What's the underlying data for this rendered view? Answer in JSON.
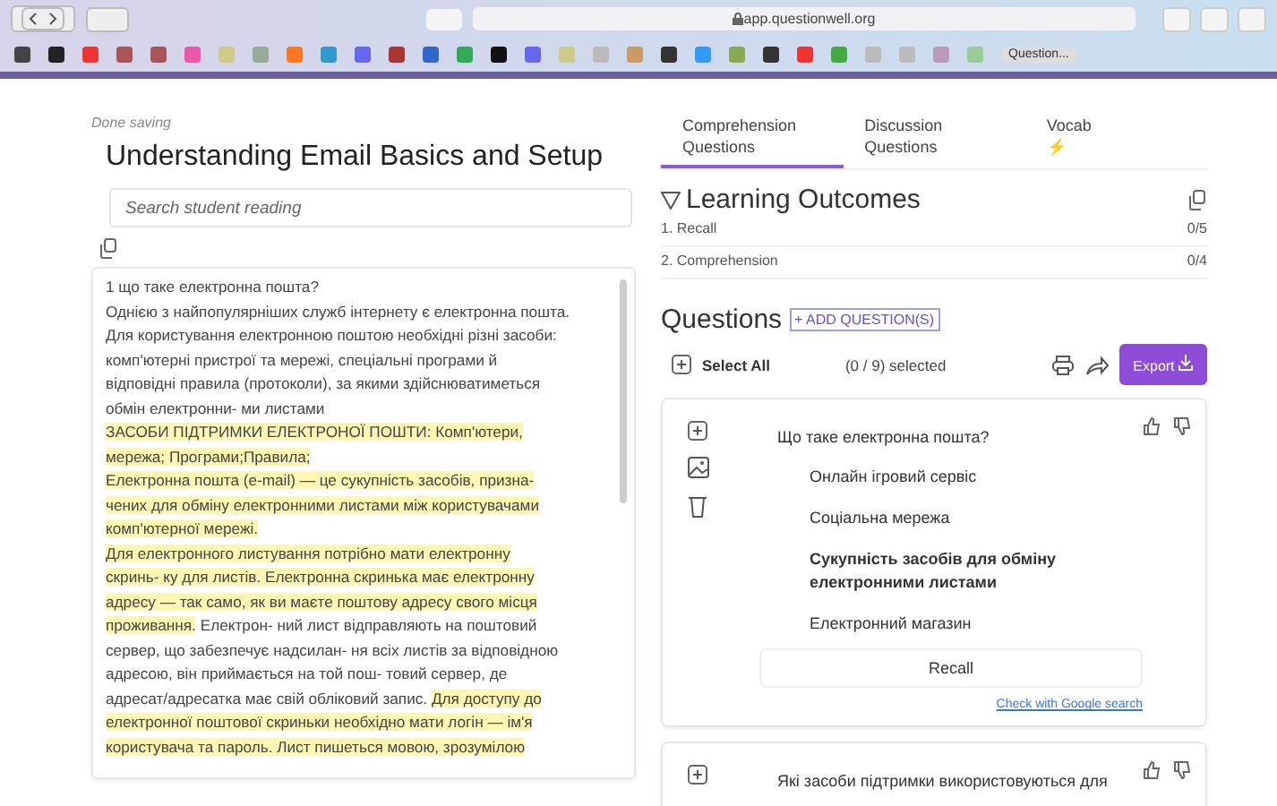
{
  "browser": {
    "url": "app.questionwell.org",
    "bookmark_label": "Question..."
  },
  "left": {
    "status": "Done saving",
    "title": "Understanding Email Basics and Setup",
    "search": {
      "placeholder": "Search student reading"
    },
    "passage": [
      [
        {
          "text": "1 що таке електронна пошта?",
          "highlighted": false
        }
      ],
      [
        {
          "text": "Однією з найпопулярніших служб інтернету є електронна пошта.",
          "highlighted": false
        }
      ],
      [
        {
          "text": "Для користування електронною поштою необхідні різні засоби:",
          "highlighted": false
        }
      ],
      [
        {
          "text": "комп'ютерні пристрої та мережі, спеціальні програми й",
          "highlighted": false
        }
      ],
      [
        {
          "text": "відповідні правила (протоколи), за якими здійснюватиметься",
          "highlighted": false
        }
      ],
      [
        {
          "text": "обмін електронни- ми листами",
          "highlighted": false
        }
      ],
      [
        {
          "text": "ЗАСОБИ ПІДТРИМКИ ЕЛЕКТРОНОЇ ПОШТИ: Комп'ютери,",
          "highlighted": true
        }
      ],
      [
        {
          "text": "мережа; Програми;Правила;",
          "highlighted": true
        }
      ],
      [
        {
          "text": "Електронна пошта (e-mail) — це сукупність засобів, призна-",
          "highlighted": true
        }
      ],
      [
        {
          "text": "чених для обміну електронними листами між користувачами",
          "highlighted": true
        }
      ],
      [
        {
          "text": "комп'ютерної мережі.",
          "highlighted": true
        }
      ],
      [
        {
          "text": "Для електронного листування потрібно мати електронну",
          "highlighted": true
        }
      ],
      [
        {
          "text": "скринь- ку для листів. Електронна скринька має електронну",
          "highlighted": true
        }
      ],
      [
        {
          "text": "адресу — так само, як ви маєте поштову адресу свого місця",
          "highlighted": true
        }
      ],
      [
        {
          "text": "проживання.",
          "highlighted": true
        },
        {
          "text": " Електрон- ний лист відправляють на поштовий",
          "highlighted": false
        }
      ],
      [
        {
          "text": "сервер, що забезпечує надсилан- ня всіх листів за відповідною",
          "highlighted": false
        }
      ],
      [
        {
          "text": "адресою, він приймається на той пош- товий сервер, де",
          "highlighted": false
        }
      ],
      [
        {
          "text": "адресат/адресатка має свій обліковий запис. ",
          "highlighted": false
        },
        {
          "text": "Для доступу до",
          "highlighted": true
        }
      ],
      [
        {
          "text": "електронної поштової скриньки необхідно мати логін — ім'я",
          "highlighted": true
        }
      ],
      [
        {
          "text": "користувача та пароль. Лист пишеться мовою, зрозумілою",
          "highlighted": true
        }
      ]
    ]
  },
  "tabs": [
    {
      "label": "Comprehension Questions",
      "selected": true
    },
    {
      "label": "Discussion Questions",
      "selected": false
    },
    {
      "label": "Vocab",
      "selected": false,
      "icon": "⚡"
    }
  ],
  "outcomes": {
    "title": "Learning Outcomes",
    "items": [
      {
        "label": "1. Recall",
        "count": "0/5"
      },
      {
        "label": "2. Comprehension",
        "count": "0/4"
      }
    ]
  },
  "questions": {
    "title": "Questions",
    "add_label": "+ ADD QUESTION(S)",
    "select_all": "Select All",
    "selected_count": "(0 / 9) selected",
    "export_label": "Export",
    "cards": [
      {
        "question": "Що таке електронна пошта?",
        "options": [
          {
            "text": "Онлайн ігровий сервіс",
            "selected": false
          },
          {
            "text": "Соціальна мережа",
            "selected": false
          },
          {
            "text": "Сукупність засобів для обміну електронними листами",
            "selected": true
          },
          {
            "text": "Електронний магазин",
            "selected": false
          }
        ],
        "outcome": "Recall",
        "link": "Check with Google search"
      },
      {
        "question": "Які засоби підтримки використовуються для"
      }
    ]
  }
}
